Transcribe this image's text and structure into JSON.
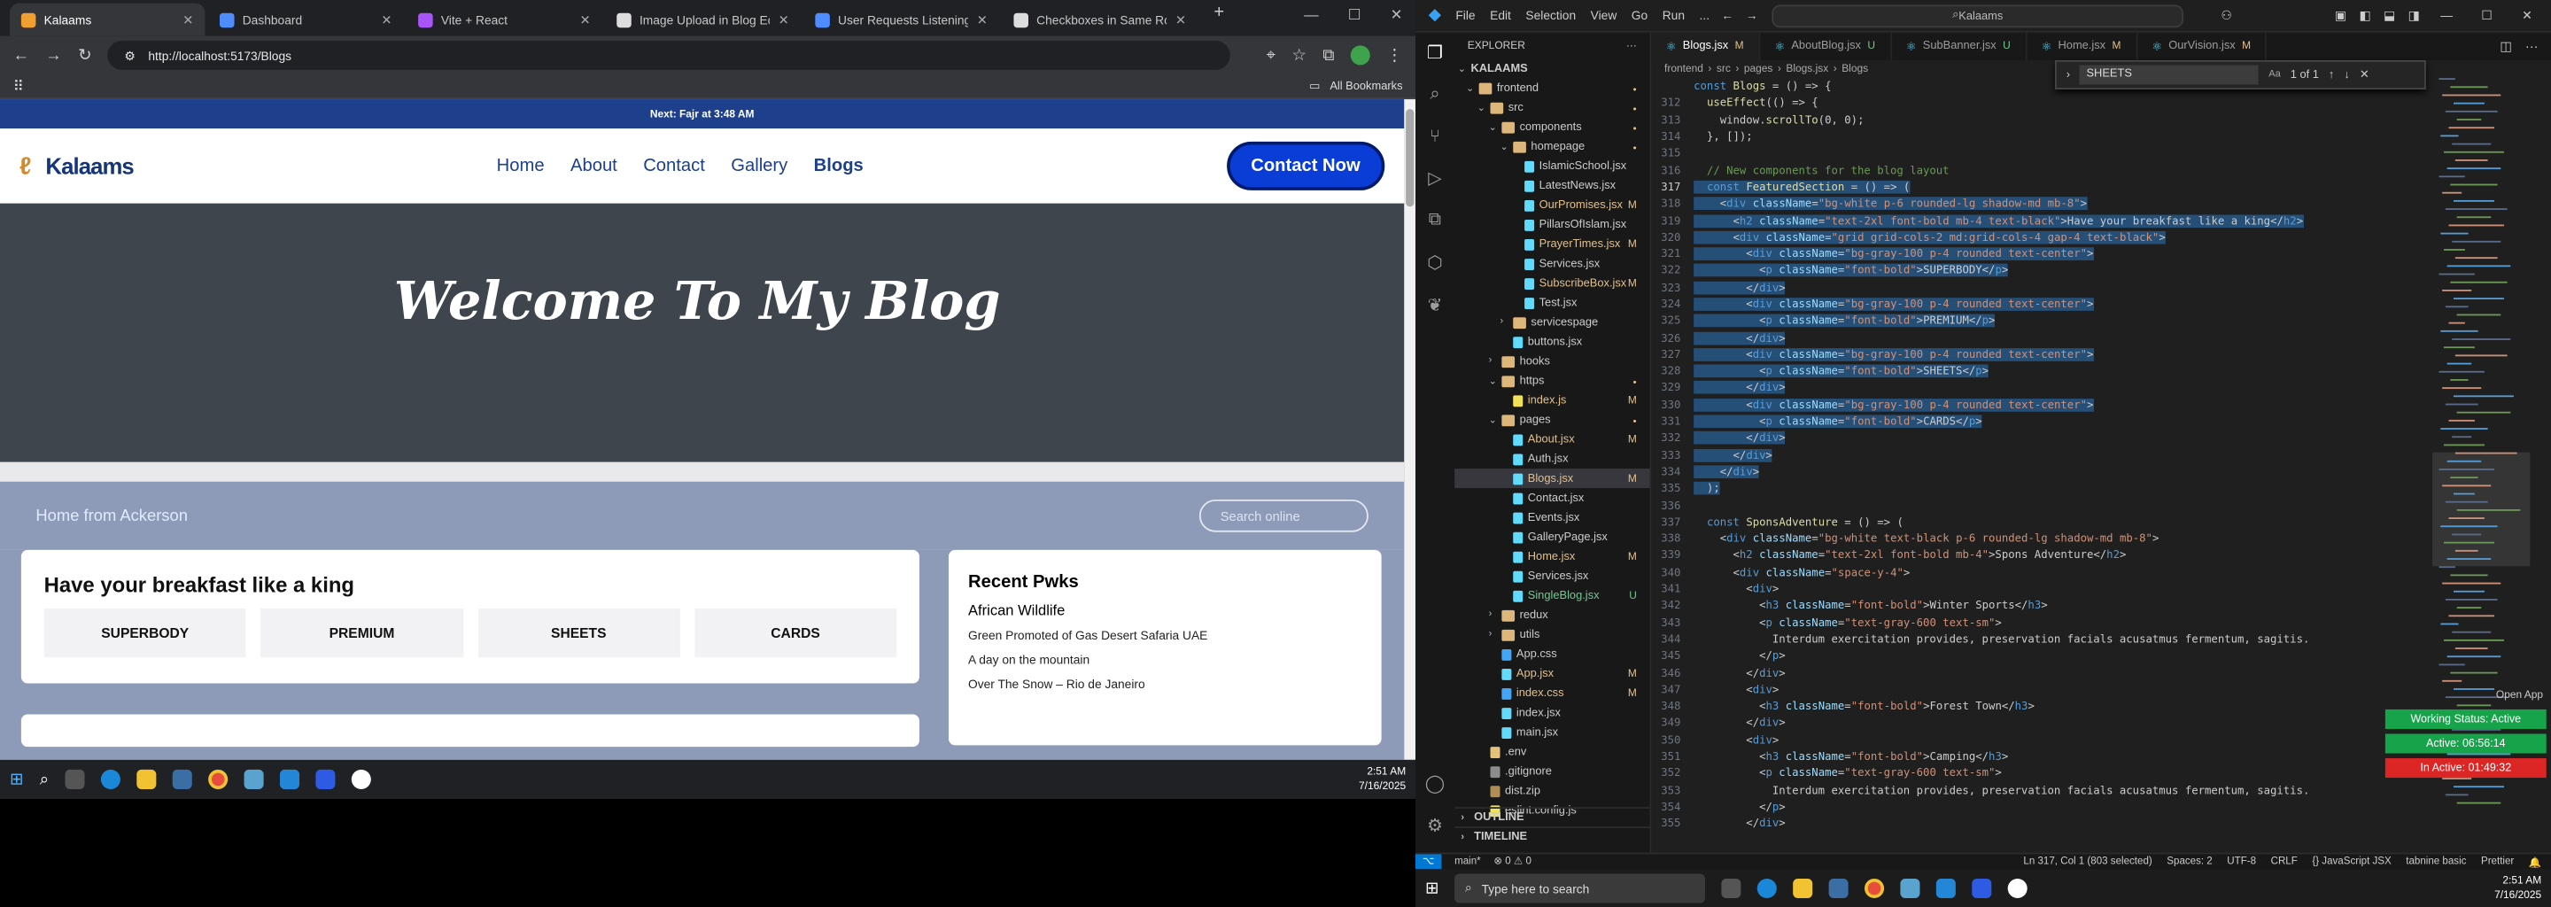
{
  "browser": {
    "tabs": [
      {
        "label": "Kalaams",
        "color": "#f0a030",
        "active": true
      },
      {
        "label": "Dashboard",
        "color": "#4f8cff",
        "active": false
      },
      {
        "label": "Vite + React",
        "color": "#a855f7",
        "active": false
      },
      {
        "label": "Image Upload in Blog Editor",
        "color": "#dddddd",
        "active": false
      },
      {
        "label": "User Requests Listening Assi",
        "color": "#4f8cff",
        "active": false
      },
      {
        "label": "Checkboxes in Same Row",
        "color": "#dddddd",
        "active": false
      }
    ],
    "url": "http://localhost:5173/Blogs",
    "bookmarks_label": "All Bookmarks"
  },
  "site": {
    "announcement": "Next: Fajr at 3:48 AM",
    "logo_text": "Kalaams",
    "menu": [
      "Home",
      "About",
      "Contact",
      "Gallery",
      "Blogs"
    ],
    "active_menu": "Blogs",
    "cta": "Contact Now",
    "hero_title": "Welcome To My Blog",
    "breadcrumb": "Home from Ackerson",
    "search_placeholder": "Search online",
    "featured_title": "Have your breakfast like a king",
    "featured_items": [
      "SUPERBODY",
      "PREMIUM",
      "SHEETS",
      "CARDS"
    ],
    "recent_title": "Recent Pwks",
    "recent_lead": "African Wildlife",
    "recent_items": [
      "Green Promoted of Gas Desert Safaria UAE",
      "A day on the mountain",
      "Over The Snow – Rio de Janeiro"
    ]
  },
  "taskbar_left": {
    "time": "2:51 AM",
    "date": "7/16/2025"
  },
  "vscode": {
    "menu": [
      "File",
      "Edit",
      "Selection",
      "View",
      "Go",
      "Run",
      "..."
    ],
    "command_center": "Kalaams",
    "explorer_title": "EXPLORER",
    "root": "KALAAMS",
    "tree": [
      {
        "depth": 1,
        "name": "frontend",
        "type": "folder",
        "open": true,
        "status": "dot"
      },
      {
        "depth": 2,
        "name": "src",
        "type": "folder",
        "open": true,
        "status": "dot"
      },
      {
        "depth": 3,
        "name": "components",
        "type": "folder",
        "open": true,
        "status": "dot"
      },
      {
        "depth": 4,
        "name": "homepage",
        "type": "folder",
        "open": true,
        "status": "dot"
      },
      {
        "depth": 5,
        "name": "IslamicSchool.jsx",
        "type": "file",
        "status": ""
      },
      {
        "depth": 5,
        "name": "LatestNews.jsx",
        "type": "file",
        "status": ""
      },
      {
        "depth": 5,
        "name": "OurPromises.jsx",
        "type": "file",
        "status": "M"
      },
      {
        "depth": 5,
        "name": "PillarsOfIslam.jsx",
        "type": "file",
        "status": ""
      },
      {
        "depth": 5,
        "name": "PrayerTimes.jsx",
        "type": "file",
        "status": "M"
      },
      {
        "depth": 5,
        "name": "Services.jsx",
        "type": "file",
        "status": ""
      },
      {
        "depth": 5,
        "name": "SubscribeBox.jsx",
        "type": "file",
        "status": "M"
      },
      {
        "depth": 5,
        "name": "Test.jsx",
        "type": "file",
        "status": ""
      },
      {
        "depth": 4,
        "name": "servicespage",
        "type": "folder",
        "open": false,
        "status": ""
      },
      {
        "depth": 4,
        "name": "buttons.jsx",
        "type": "file",
        "status": ""
      },
      {
        "depth": 3,
        "name": "hooks",
        "type": "folder",
        "open": false,
        "status": ""
      },
      {
        "depth": 3,
        "name": "https",
        "type": "folder",
        "open": true,
        "status": "dot"
      },
      {
        "depth": 4,
        "name": "index.js",
        "type": "file",
        "status": "M"
      },
      {
        "depth": 3,
        "name": "pages",
        "type": "folder",
        "open": true,
        "status": "dot"
      },
      {
        "depth": 4,
        "name": "About.jsx",
        "type": "file",
        "status": "M"
      },
      {
        "depth": 4,
        "name": "Auth.jsx",
        "type": "file",
        "status": ""
      },
      {
        "depth": 4,
        "name": "Blogs.jsx",
        "type": "file",
        "status": "M",
        "selected": true
      },
      {
        "depth": 4,
        "name": "Contact.jsx",
        "type": "file",
        "status": ""
      },
      {
        "depth": 4,
        "name": "Events.jsx",
        "type": "file",
        "status": ""
      },
      {
        "depth": 4,
        "name": "GalleryPage.jsx",
        "type": "file",
        "status": ""
      },
      {
        "depth": 4,
        "name": "Home.jsx",
        "type": "file",
        "status": "M"
      },
      {
        "depth": 4,
        "name": "Services.jsx",
        "type": "file",
        "status": ""
      },
      {
        "depth": 4,
        "name": "SingleBlog.jsx",
        "type": "file",
        "status": "U"
      },
      {
        "depth": 3,
        "name": "redux",
        "type": "folder",
        "open": false,
        "status": ""
      },
      {
        "depth": 3,
        "name": "utils",
        "type": "folder",
        "open": false,
        "status": ""
      },
      {
        "depth": 3,
        "name": "App.css",
        "type": "file",
        "status": ""
      },
      {
        "depth": 3,
        "name": "App.jsx",
        "type": "file",
        "status": "M"
      },
      {
        "depth": 3,
        "name": "index.css",
        "type": "file",
        "status": "M"
      },
      {
        "depth": 3,
        "name": "index.jsx",
        "type": "file",
        "status": ""
      },
      {
        "depth": 3,
        "name": "main.jsx",
        "type": "file",
        "status": ""
      },
      {
        "depth": 2,
        "name": ".env",
        "type": "file",
        "status": ""
      },
      {
        "depth": 2,
        "name": ".gitignore",
        "type": "file",
        "status": ""
      },
      {
        "depth": 2,
        "name": "dist.zip",
        "type": "file",
        "status": ""
      },
      {
        "depth": 2,
        "name": "eslint.config.js",
        "type": "file",
        "status": ""
      }
    ],
    "outline": "OUTLINE",
    "timeline": "TIMELINE",
    "editor_tabs": [
      {
        "label": "Blogs.jsx",
        "badge": "M",
        "active": true
      },
      {
        "label": "AboutBlog.jsx",
        "badge": "U",
        "active": false
      },
      {
        "label": "SubBanner.jsx",
        "badge": "U",
        "active": false
      },
      {
        "label": "Home.jsx",
        "badge": "M",
        "active": false
      },
      {
        "label": "OurVision.jsx",
        "badge": "M",
        "active": false
      }
    ],
    "breadcrumbs": [
      "frontend",
      "src",
      "pages",
      "Blogs.jsx",
      "Blogs"
    ],
    "find_text": "SHEETS",
    "find_result": "1 of 1",
    "code_lines": [
      {
        "n": "",
        "t": "const Blogs = () => {",
        "hl": false
      },
      {
        "n": "312",
        "t": "  useEffect(() => {",
        "hl": false
      },
      {
        "n": "313",
        "t": "    window.scrollTo(0, 0);",
        "hl": false
      },
      {
        "n": "314",
        "t": "  }, []);",
        "hl": false
      },
      {
        "n": "315",
        "t": "",
        "hl": false
      },
      {
        "n": "316",
        "t": "  // New components for the blog layout",
        "hl": false
      },
      {
        "n": "317",
        "t": "  const FeaturedSection = () => (",
        "hl": true
      },
      {
        "n": "318",
        "t": "    <div className=\"bg-white p-6 rounded-lg shadow-md mb-8\">",
        "hl": true
      },
      {
        "n": "319",
        "t": "      <h2 className=\"text-2xl font-bold mb-4 text-black\">Have your breakfast like a king</h2>",
        "hl": true
      },
      {
        "n": "320",
        "t": "      <div className=\"grid grid-cols-2 md:grid-cols-4 gap-4 text-black\">",
        "hl": true
      },
      {
        "n": "321",
        "t": "        <div className=\"bg-gray-100 p-4 rounded text-center\">",
        "hl": true
      },
      {
        "n": "322",
        "t": "          <p className=\"font-bold\">SUPERBODY</p>",
        "hl": true
      },
      {
        "n": "323",
        "t": "        </div>",
        "hl": true
      },
      {
        "n": "324",
        "t": "        <div className=\"bg-gray-100 p-4 rounded text-center\">",
        "hl": true
      },
      {
        "n": "325",
        "t": "          <p className=\"font-bold\">PREMIUM</p>",
        "hl": true
      },
      {
        "n": "326",
        "t": "        </div>",
        "hl": true
      },
      {
        "n": "327",
        "t": "        <div className=\"bg-gray-100 p-4 rounded text-center\">",
        "hl": true
      },
      {
        "n": "328",
        "t": "          <p className=\"font-bold\">SHEETS</p>",
        "hl": true
      },
      {
        "n": "329",
        "t": "        </div>",
        "hl": true
      },
      {
        "n": "330",
        "t": "        <div className=\"bg-gray-100 p-4 rounded text-center\">",
        "hl": true
      },
      {
        "n": "331",
        "t": "          <p className=\"font-bold\">CARDS</p>",
        "hl": true
      },
      {
        "n": "332",
        "t": "        </div>",
        "hl": true
      },
      {
        "n": "333",
        "t": "      </div>",
        "hl": true
      },
      {
        "n": "334",
        "t": "    </div>",
        "hl": true
      },
      {
        "n": "335",
        "t": "  );",
        "hl": true
      },
      {
        "n": "336",
        "t": "",
        "hl": false
      },
      {
        "n": "337",
        "t": "  const SponsAdventure = () => (",
        "hl": false
      },
      {
        "n": "338",
        "t": "    <div className=\"bg-white text-black p-6 rounded-lg shadow-md mb-8\">",
        "hl": false
      },
      {
        "n": "339",
        "t": "      <h2 className=\"text-2xl font-bold mb-4\">Spons Adventure</h2>",
        "hl": false
      },
      {
        "n": "340",
        "t": "      <div className=\"space-y-4\">",
        "hl": false
      },
      {
        "n": "341",
        "t": "        <div>",
        "hl": false
      },
      {
        "n": "342",
        "t": "          <h3 className=\"font-bold\">Winter Sports</h3>",
        "hl": false
      },
      {
        "n": "343",
        "t": "          <p className=\"text-gray-600 text-sm\">",
        "hl": false
      },
      {
        "n": "344",
        "t": "            Interdum exercitation provides, preservation facials acusatmus fermentum, sagitis.",
        "hl": false
      },
      {
        "n": "345",
        "t": "          </p>",
        "hl": false
      },
      {
        "n": "346",
        "t": "        </div>",
        "hl": false
      },
      {
        "n": "347",
        "t": "        <div>",
        "hl": false
      },
      {
        "n": "348",
        "t": "          <h3 className=\"font-bold\">Forest Town</h3>",
        "hl": false
      },
      {
        "n": "349",
        "t": "        </div>",
        "hl": false
      },
      {
        "n": "350",
        "t": "        <div>",
        "hl": false
      },
      {
        "n": "351",
        "t": "          <h3 className=\"font-bold\">Camping</h3>",
        "hl": false
      },
      {
        "n": "352",
        "t": "          <p className=\"text-gray-600 text-sm\">",
        "hl": false
      },
      {
        "n": "353",
        "t": "            Interdum exercitation provides, preservation facials acusatmus fermentum, sagitis.",
        "hl": false
      },
      {
        "n": "354",
        "t": "          </p>",
        "hl": false
      },
      {
        "n": "355",
        "t": "        </div>",
        "hl": false
      }
    ],
    "open_app": "Open App",
    "pills": [
      {
        "label": "Working Status: Active",
        "color": "#16a34a"
      },
      {
        "label": "Active: 06:56:14",
        "color": "#16a34a"
      },
      {
        "label": "In Active: 01:49:32",
        "color": "#dc2626"
      }
    ],
    "status_bar": {
      "branch": "main*",
      "problems": "⊗ 0 ⚠ 0",
      "position": "Ln 317, Col 1 (803 selected)",
      "spaces": "Spaces: 2",
      "encoding": "UTF-8",
      "eol": "CRLF",
      "language": "{} JavaScript JSX",
      "tabnine": "tabnine basic",
      "prettier": "Prettier"
    }
  },
  "taskbar_right": {
    "search_placeholder": "Type here to search",
    "time": "2:51 AM",
    "date": "7/16/2025"
  }
}
